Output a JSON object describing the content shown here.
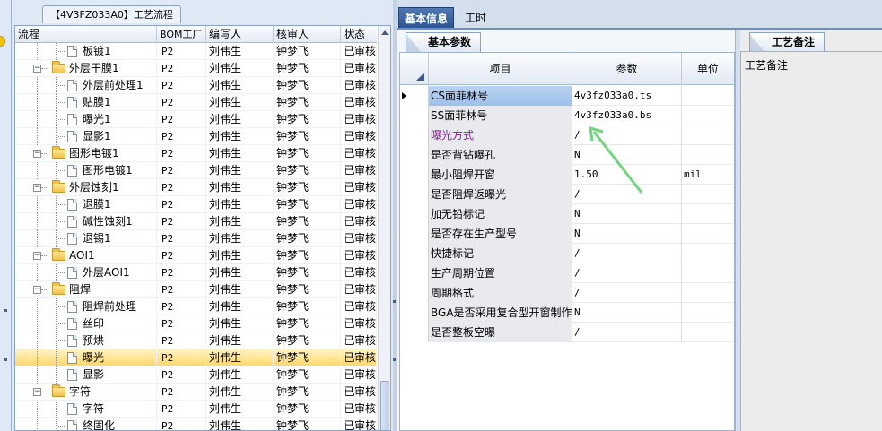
{
  "tree_panel": {
    "tab_title": "【4V3FZ033A0】工艺流程",
    "columns": [
      "流程",
      "BOM工厂",
      "编写人",
      "核审人",
      "状态"
    ],
    "rows": [
      {
        "name": "板镀1",
        "level": 2,
        "type": "doc",
        "bom": "P2",
        "writer": "刘伟生",
        "reviewer": "钟梦飞",
        "status": "已审核",
        "selected": false
      },
      {
        "name": "外层干膜1",
        "level": 1,
        "type": "folder",
        "bom": "P2",
        "writer": "刘伟生",
        "reviewer": "钟梦飞",
        "status": "已审核",
        "selected": false
      },
      {
        "name": "外层前处理1",
        "level": 2,
        "type": "doc",
        "bom": "P2",
        "writer": "刘伟生",
        "reviewer": "钟梦飞",
        "status": "已审核",
        "selected": false
      },
      {
        "name": "贴膜1",
        "level": 2,
        "type": "doc",
        "bom": "P2",
        "writer": "刘伟生",
        "reviewer": "钟梦飞",
        "status": "已审核",
        "selected": false
      },
      {
        "name": "曝光1",
        "level": 2,
        "type": "doc",
        "bom": "P2",
        "writer": "刘伟生",
        "reviewer": "钟梦飞",
        "status": "已审核",
        "selected": false
      },
      {
        "name": "显影1",
        "level": 2,
        "type": "doc",
        "bom": "P2",
        "writer": "刘伟生",
        "reviewer": "钟梦飞",
        "status": "已审核",
        "selected": false
      },
      {
        "name": "图形电镀1",
        "level": 1,
        "type": "folder",
        "bom": "P2",
        "writer": "刘伟生",
        "reviewer": "钟梦飞",
        "status": "已审核",
        "selected": false
      },
      {
        "name": "图形电镀1",
        "level": 2,
        "type": "doc",
        "bom": "P2",
        "writer": "刘伟生",
        "reviewer": "钟梦飞",
        "status": "已审核",
        "selected": false
      },
      {
        "name": "外层蚀刻1",
        "level": 1,
        "type": "folder",
        "bom": "P2",
        "writer": "刘伟生",
        "reviewer": "钟梦飞",
        "status": "已审核",
        "selected": false
      },
      {
        "name": "退膜1",
        "level": 2,
        "type": "doc",
        "bom": "P2",
        "writer": "刘伟生",
        "reviewer": "钟梦飞",
        "status": "已审核",
        "selected": false
      },
      {
        "name": "碱性蚀刻1",
        "level": 2,
        "type": "doc",
        "bom": "P2",
        "writer": "刘伟生",
        "reviewer": "钟梦飞",
        "status": "已审核",
        "selected": false
      },
      {
        "name": "退锡1",
        "level": 2,
        "type": "doc",
        "bom": "P2",
        "writer": "刘伟生",
        "reviewer": "钟梦飞",
        "status": "已审核",
        "selected": false
      },
      {
        "name": "AOI1",
        "level": 1,
        "type": "folder",
        "bom": "P2",
        "writer": "刘伟生",
        "reviewer": "钟梦飞",
        "status": "已审核",
        "selected": false
      },
      {
        "name": "外层AOI1",
        "level": 2,
        "type": "doc",
        "bom": "P2",
        "writer": "刘伟生",
        "reviewer": "钟梦飞",
        "status": "已审核",
        "selected": false
      },
      {
        "name": "阻焊",
        "level": 1,
        "type": "folder",
        "bom": "P2",
        "writer": "刘伟生",
        "reviewer": "钟梦飞",
        "status": "已审核",
        "selected": false
      },
      {
        "name": "阻焊前处理",
        "level": 2,
        "type": "doc",
        "bom": "P2",
        "writer": "刘伟生",
        "reviewer": "钟梦飞",
        "status": "已审核",
        "selected": false
      },
      {
        "name": "丝印",
        "level": 2,
        "type": "doc",
        "bom": "P2",
        "writer": "刘伟生",
        "reviewer": "钟梦飞",
        "status": "已审核",
        "selected": false
      },
      {
        "name": "预烘",
        "level": 2,
        "type": "doc",
        "bom": "P2",
        "writer": "刘伟生",
        "reviewer": "钟梦飞",
        "status": "已审核",
        "selected": false
      },
      {
        "name": "曝光",
        "level": 2,
        "type": "doc",
        "bom": "P2",
        "writer": "刘伟生",
        "reviewer": "钟梦飞",
        "status": "已审核",
        "selected": true
      },
      {
        "name": "显影",
        "level": 2,
        "type": "doc",
        "bom": "P2",
        "writer": "刘伟生",
        "reviewer": "钟梦飞",
        "status": "已审核",
        "selected": false
      },
      {
        "name": "字符",
        "level": 1,
        "type": "folder",
        "bom": "P2",
        "writer": "刘伟生",
        "reviewer": "钟梦飞",
        "status": "已审核",
        "selected": false
      },
      {
        "name": "字符",
        "level": 2,
        "type": "doc",
        "bom": "P2",
        "writer": "刘伟生",
        "reviewer": "钟梦飞",
        "status": "已审核",
        "selected": false
      },
      {
        "name": "终固化",
        "level": 2,
        "type": "doc",
        "bom": "P2",
        "writer": "刘伟生",
        "reviewer": "钟梦飞",
        "status": "已审核",
        "selected": false
      }
    ]
  },
  "top_tabs": [
    {
      "label": "基本信息",
      "active": true
    },
    {
      "label": "工时",
      "active": false
    }
  ],
  "basic_panel": {
    "tab_label": "基本参数",
    "columns": [
      "项目",
      "参数",
      "单位"
    ],
    "rows": [
      {
        "name": "CS面菲林号",
        "value": "4v3fz033a0.ts",
        "unit": "",
        "current": true,
        "selected": true,
        "highlight": false
      },
      {
        "name": "SS面菲林号",
        "value": "4v3fz033a0.bs",
        "unit": "",
        "current": false,
        "selected": false,
        "highlight": false
      },
      {
        "name": "曝光方式",
        "value": "/",
        "unit": "",
        "current": false,
        "selected": false,
        "highlight": true
      },
      {
        "name": "是否背钻曝孔",
        "value": "N",
        "unit": "",
        "current": false,
        "selected": false,
        "highlight": false
      },
      {
        "name": "最小阻焊开窗",
        "value": "1.50",
        "unit": "mil",
        "current": false,
        "selected": false,
        "highlight": false
      },
      {
        "name": "是否阻焊返曝光",
        "value": "/",
        "unit": "",
        "current": false,
        "selected": false,
        "highlight": false
      },
      {
        "name": "加无铅标记",
        "value": "N",
        "unit": "",
        "current": false,
        "selected": false,
        "highlight": false
      },
      {
        "name": "是否存在生产型号",
        "value": "N",
        "unit": "",
        "current": false,
        "selected": false,
        "highlight": false
      },
      {
        "name": "快捷标记",
        "value": "/",
        "unit": "",
        "current": false,
        "selected": false,
        "highlight": false
      },
      {
        "name": "生产周期位置",
        "value": "/",
        "unit": "",
        "current": false,
        "selected": false,
        "highlight": false
      },
      {
        "name": "周期格式",
        "value": "/",
        "unit": "",
        "current": false,
        "selected": false,
        "highlight": false
      },
      {
        "name": "BGA是否采用复合型开窗制作",
        "value": "N",
        "unit": "",
        "current": false,
        "selected": false,
        "highlight": false
      },
      {
        "name": "是否整板空曝",
        "value": "/",
        "unit": "",
        "current": false,
        "selected": false,
        "highlight": false
      }
    ]
  },
  "note_panel": {
    "tab_label": "工艺备注",
    "label": "工艺备注"
  },
  "colors": {
    "accent": "#2d5593",
    "selected_row": "#ffd86c",
    "highlight_text": "#8e1a9c",
    "annotation_arrow": "#6fd67a"
  }
}
